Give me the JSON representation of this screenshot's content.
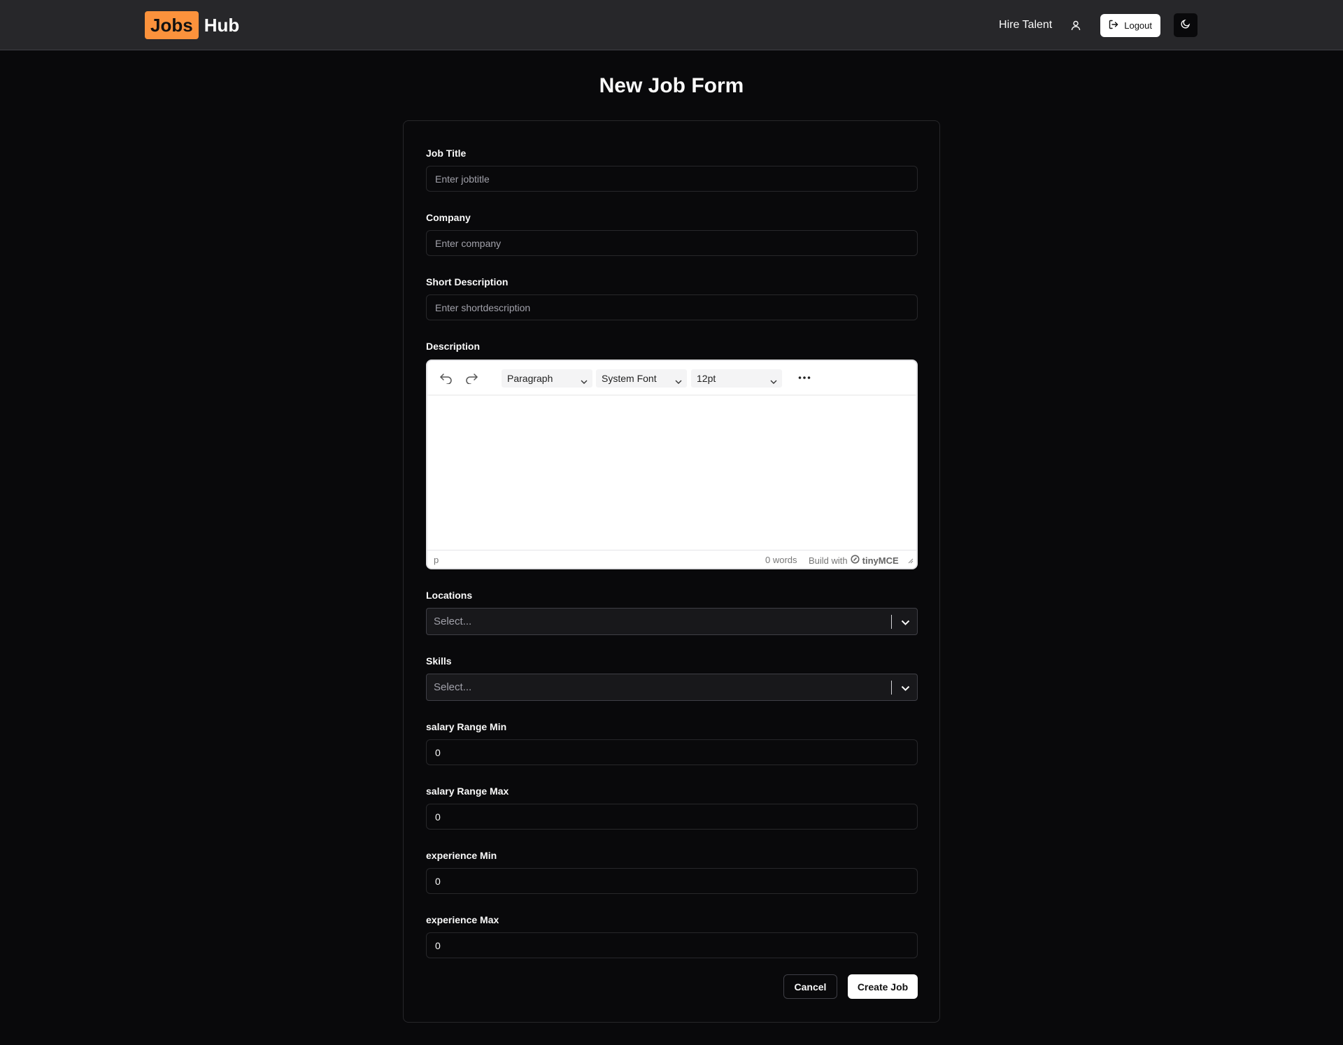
{
  "header": {
    "logo_badge": "Jobs",
    "logo_text": "Hub",
    "hire_talent": "Hire Talent",
    "logout": "Logout",
    "accent": "#fb923c"
  },
  "page": {
    "title": "New Job Form"
  },
  "form": {
    "job_title": {
      "label": "Job Title",
      "placeholder": "Enter jobtitle"
    },
    "company": {
      "label": "Company",
      "placeholder": "Enter company"
    },
    "short_description": {
      "label": "Short Description",
      "placeholder": "Enter shortdescription"
    },
    "description": {
      "label": "Description",
      "block_format": "Paragraph",
      "font_family": "System Font",
      "font_size": "12pt",
      "status_path": "p",
      "word_count": "0 words",
      "brand_prefix": "Build with",
      "brand_name": "tinyMCE"
    },
    "locations": {
      "label": "Locations",
      "placeholder": "Select..."
    },
    "skills": {
      "label": "Skills",
      "placeholder": "Select..."
    },
    "salary_min": {
      "label": "salary Range Min",
      "value": "0"
    },
    "salary_max": {
      "label": "salary Range Max",
      "value": "0"
    },
    "experience_min": {
      "label": "experience Min",
      "value": "0"
    },
    "experience_max": {
      "label": "experience Max",
      "value": "0"
    },
    "cancel": "Cancel",
    "submit": "Create Job"
  }
}
